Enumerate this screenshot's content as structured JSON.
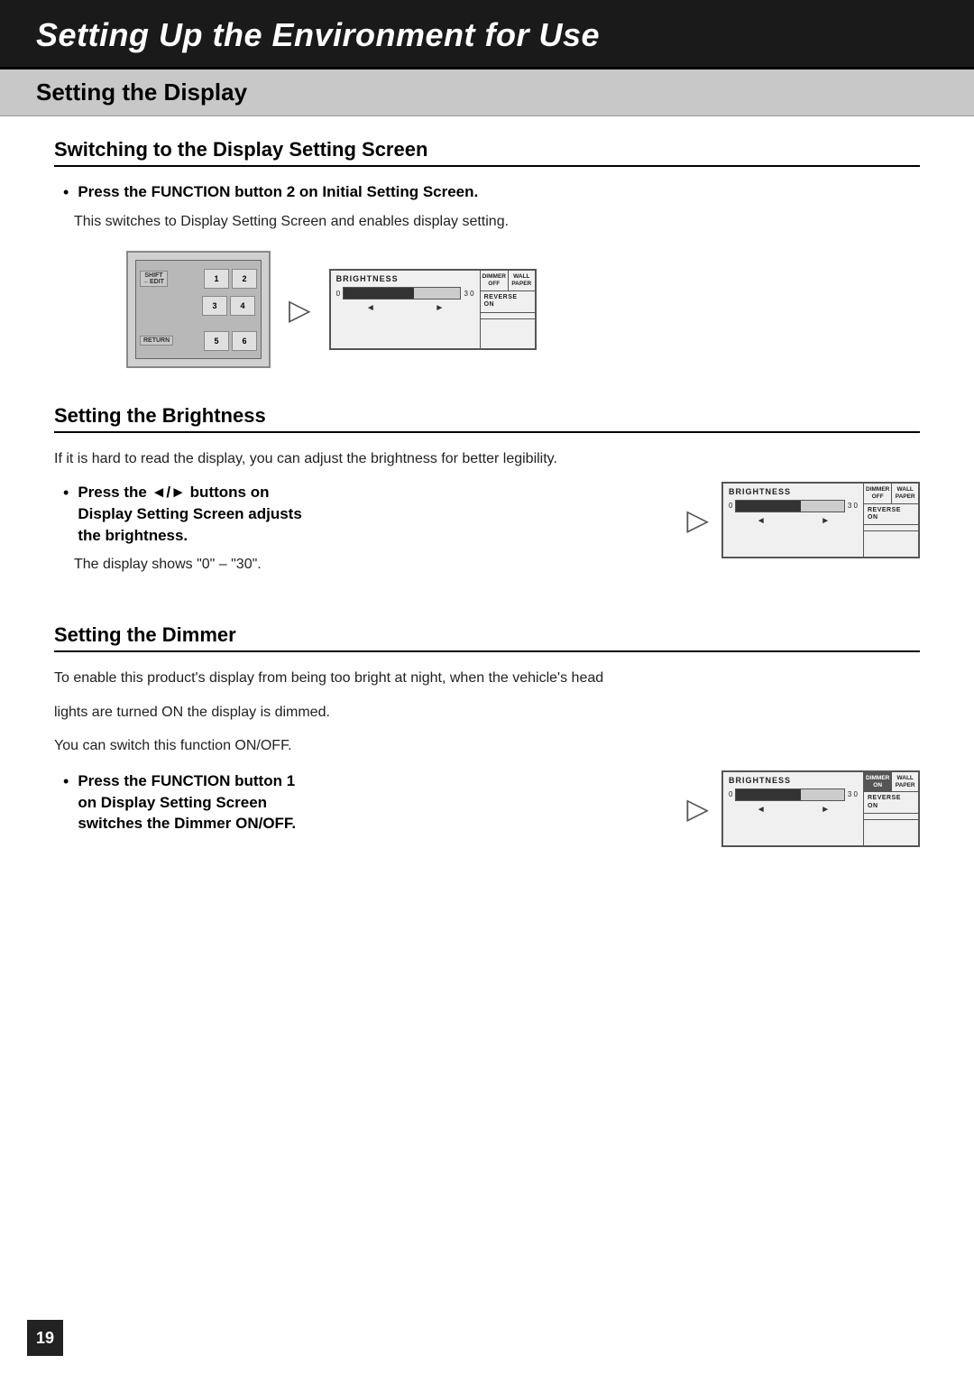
{
  "header": {
    "title": "Setting Up the Environment for Use"
  },
  "section": {
    "title": "Setting the Display"
  },
  "subsections": [
    {
      "id": "switching",
      "title": "Switching to the Display Setting Screen",
      "bullet": {
        "text": "Press the FUNCTION button 2 on Initial Setting Screen."
      },
      "body": "This switches to Display Setting Screen and enables display setting."
    },
    {
      "id": "brightness",
      "title": "Setting the Brightness",
      "intro": "If it is hard to read the display, you can adjust the brightness for better legibility.",
      "bullet": {
        "line1": "Press the ◄/► buttons on",
        "line2": "Display Setting Screen adjusts",
        "line3": "the brightness."
      },
      "body": "The display shows \"0\" – \"30\"."
    },
    {
      "id": "dimmer",
      "title": "Setting the Dimmer",
      "intro1": "To enable this product's display from being too bright at night, when the vehicle's head",
      "intro2": "lights are turned ON the display is dimmed.",
      "intro3": "You can switch this function ON/OFF.",
      "bullet": {
        "line1": "Press the FUNCTION button 1",
        "line2": "on Display Setting Screen",
        "line3": "switches the Dimmer ON/OFF."
      }
    }
  ],
  "display": {
    "brightness_label": "BRIGHTNESS",
    "zero": "0",
    "thirty": "3 0",
    "dimmer_off_label": "DIMMER\nOFF",
    "dimmer_on_label": "DIMMER\nON",
    "wall_paper_label": "WALL\nPAPER",
    "reverse_on_label": "REVERSE\nON"
  },
  "page_number": "19"
}
